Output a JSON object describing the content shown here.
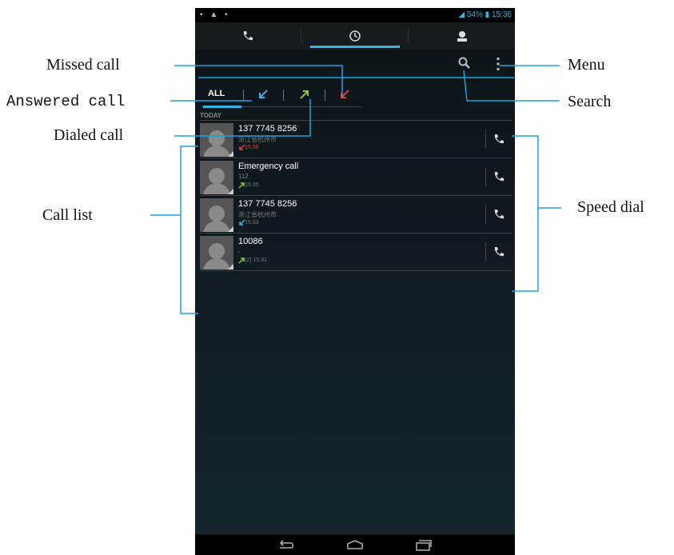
{
  "status_bar": {
    "left_icons": [
      "sd-card-icon",
      "warning-icon",
      "cat-icon"
    ],
    "battery": "54%",
    "time": "15:36"
  },
  "tabs": [
    {
      "id": "phone",
      "icon": "phone-icon"
    },
    {
      "id": "call-log",
      "icon": "clock-icon",
      "active": true
    },
    {
      "id": "contacts",
      "icon": "person-icon"
    }
  ],
  "action_bar": {
    "search_icon": "search-icon",
    "menu_icon": "overflow-menu-icon"
  },
  "filters": {
    "all_label": "ALL",
    "items": [
      {
        "id": "answered",
        "icon": "answered-arrow-icon",
        "color": "#33b5e5"
      },
      {
        "id": "dialed",
        "icon": "dialed-arrow-icon",
        "color": "#8acd2c"
      },
      {
        "id": "missed",
        "icon": "missed-arrow-icon",
        "color": "#e43b2c"
      }
    ]
  },
  "section_header": "TODAY",
  "calls": [
    {
      "name": "137 7745 8256",
      "sub": "浙江省杭州市",
      "time": "15:36",
      "type": "missed"
    },
    {
      "name": "Emergency call",
      "sub": "112",
      "time": "15:35",
      "type": "dialed"
    },
    {
      "name": "137 7745 8256",
      "sub": "浙江省杭州市",
      "time": "15:33",
      "type": "answered"
    },
    {
      "name": "10086",
      "sub": "-",
      "time": "(2)  15:31",
      "type": "dialed"
    }
  ],
  "annotations": {
    "missed_call": "Missed call",
    "answered_call": "Answered call",
    "dialed_call": "Dialed call",
    "call_list": "Call list",
    "menu": "Menu",
    "search": "Search",
    "speed_dial": "Speed dial"
  },
  "colors": {
    "accent": "#33b5e5",
    "missed": "#e43b2c",
    "dialed": "#8acd2c",
    "answered": "#33b5e5"
  }
}
